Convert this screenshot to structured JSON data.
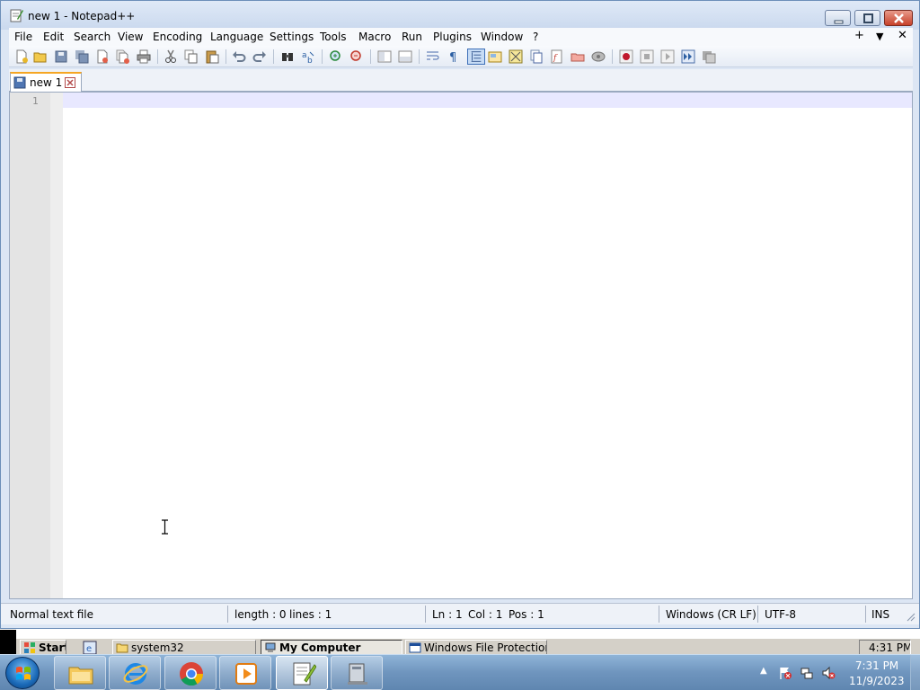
{
  "window": {
    "title": "new 1 - Notepad++"
  },
  "menu": {
    "items": [
      "File",
      "Edit",
      "Search",
      "View",
      "Encoding",
      "Language",
      "Settings",
      "Tools",
      "Macro",
      "Run",
      "Plugins",
      "Window",
      "?"
    ],
    "right_plus": "+",
    "right_down": "▼",
    "right_close": "✕"
  },
  "toolbar": {
    "icons": [
      "new-file-icon",
      "open-file-icon",
      "save-icon",
      "save-all-icon",
      "close-icon",
      "close-all-icon",
      "print-icon",
      "cut-icon",
      "copy-icon",
      "paste-icon",
      "undo-icon",
      "redo-icon",
      "find-icon",
      "replace-icon",
      "zoom-in-icon",
      "zoom-out-icon",
      "sync-vertical-icon",
      "sync-horizontal-icon",
      "word-wrap-icon",
      "show-all-characters-icon",
      "indent-guide-icon",
      "user-defined-language-icon",
      "document-map-icon",
      "document-list-icon",
      "function-list-icon",
      "folder-as-workspace-icon",
      "monitoring-icon",
      "record-macro-icon",
      "stop-recording-icon",
      "play-macro-icon",
      "run-macro-multiple-icon",
      "save-macro-icon"
    ]
  },
  "tabs": [
    {
      "label": "new 1",
      "active": true
    }
  ],
  "editor": {
    "line_number": "1",
    "content": ""
  },
  "status": {
    "file_type": "Normal text file",
    "length": "length : 0",
    "lines": "lines : 1",
    "ln": "Ln : 1",
    "col": "Col : 1",
    "pos": "Pos : 1",
    "eol": "Windows (CR LF)",
    "encoding": "UTF-8",
    "mode": "INS"
  },
  "strip": {
    "start": "Start",
    "system32": "system32",
    "my_computer": "My Computer",
    "wfp": "Windows File Protection",
    "time": "4:31 PM"
  },
  "taskbar": {
    "apps": [
      "file-explorer-icon",
      "internet-explorer-icon",
      "chrome-icon",
      "media-player-icon",
      "notepad-plus-plus-icon",
      "computer-icon"
    ],
    "clock_time": "7:31 PM",
    "clock_date": "11/9/2023",
    "tray_arrow": "▲"
  }
}
